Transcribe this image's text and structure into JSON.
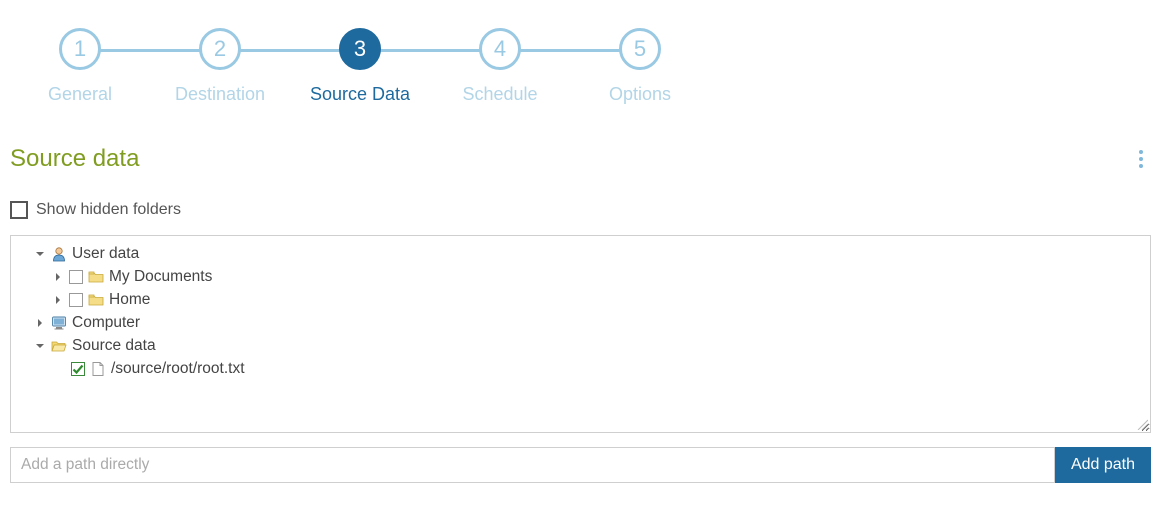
{
  "stepper": {
    "active_index": 2,
    "steps": [
      {
        "num": "1",
        "label": "General"
      },
      {
        "num": "2",
        "label": "Destination"
      },
      {
        "num": "3",
        "label": "Source Data"
      },
      {
        "num": "4",
        "label": "Schedule"
      },
      {
        "num": "5",
        "label": "Options"
      }
    ]
  },
  "section": {
    "title": "Source data"
  },
  "show_hidden": {
    "label": "Show hidden folders",
    "checked": false
  },
  "tree": {
    "items": [
      {
        "indent": 0,
        "expanded": true,
        "check": "none",
        "icon": "user",
        "label": "User data"
      },
      {
        "indent": 1,
        "expanded": false,
        "check": "unchecked",
        "icon": "folder-closed-y",
        "label": "My Documents"
      },
      {
        "indent": 1,
        "expanded": false,
        "check": "unchecked",
        "icon": "folder-closed-y",
        "label": "Home"
      },
      {
        "indent": 0,
        "expanded": false,
        "check": "none",
        "icon": "computer",
        "label": "Computer"
      },
      {
        "indent": 0,
        "expanded": true,
        "check": "none",
        "icon": "folder-open-y",
        "label": "Source data"
      },
      {
        "indent": 2,
        "expanded": null,
        "check": "checked",
        "icon": "file",
        "label": "/source/root/root.txt"
      }
    ]
  },
  "path_field": {
    "placeholder": "Add a path directly",
    "value": ""
  },
  "buttons": {
    "add_path": "Add path"
  }
}
